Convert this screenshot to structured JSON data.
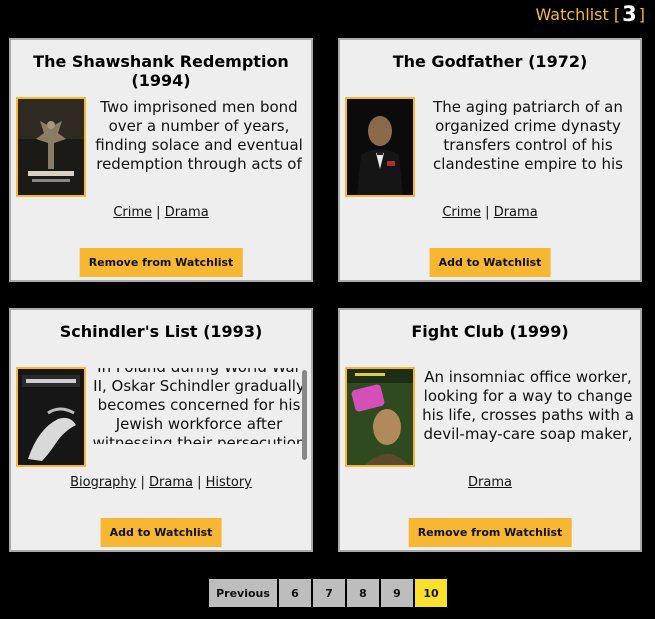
{
  "header": {
    "label": "Watchlist",
    "open_bracket": "[",
    "count": "3",
    "close_bracket": "]"
  },
  "movies": [
    {
      "title": "The Shawshank Redemption (1994)",
      "description": "Two imprisoned men bond over a number of years, finding solace and eventual redemption through acts of common decency.",
      "genres": [
        "Crime",
        "Drama"
      ],
      "button": "Remove from Watchlist",
      "poster_icon": "shawshank-poster"
    },
    {
      "title": "The Godfather (1972)",
      "description": "The aging patriarch of an organized crime dynasty transfers control of his clandestine empire to his reluctant son.",
      "genres": [
        "Crime",
        "Drama"
      ],
      "button": "Add to Watchlist",
      "poster_icon": "godfather-poster"
    },
    {
      "title": "Schindler's List (1993)",
      "description": "In Poland during World War II, Oskar Schindler gradually becomes concerned for his Jewish workforce after witnessing their persecution by the Nazis.",
      "genres": [
        "Biography",
        "Drama",
        "History"
      ],
      "button": "Add to Watchlist",
      "poster_icon": "schindlers-list-poster"
    },
    {
      "title": "Fight Club (1999)",
      "description": "An insomniac office worker, looking for a way to change his life, crosses paths with a devil-may-care soap maker, forming an underground fight club that evolves into something much, much more.",
      "genres": [
        "Drama"
      ],
      "button": "Remove from Watchlist",
      "poster_icon": "fight-club-poster"
    }
  ],
  "pagination": {
    "previous": "Previous",
    "pages": [
      "6",
      "7",
      "8",
      "9",
      "10"
    ],
    "current": "10"
  },
  "colors": {
    "accent": "#f7b733",
    "card_bg": "#eeeeee",
    "active_page": "#f9e02a",
    "page_bg": "#bdbdbd"
  }
}
